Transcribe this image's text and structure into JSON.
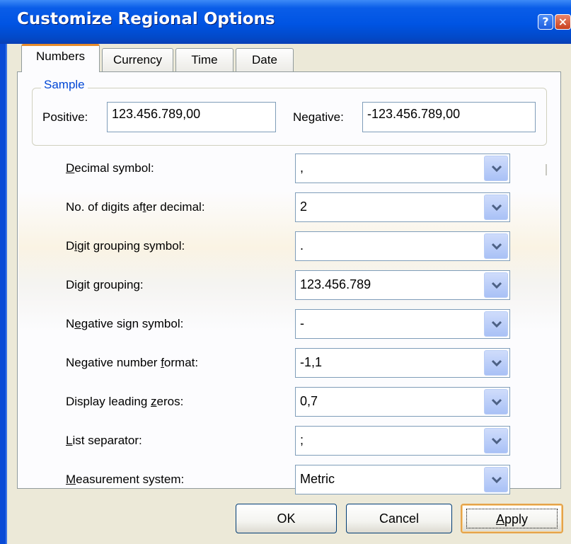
{
  "window": {
    "title": "Customize Regional Options",
    "help_glyph": "?",
    "close_glyph": "×"
  },
  "tabs": [
    {
      "label": "Numbers",
      "active": true
    },
    {
      "label": "Currency",
      "active": false
    },
    {
      "label": "Time",
      "active": false
    },
    {
      "label": "Date",
      "active": false
    }
  ],
  "sample": {
    "legend": "Sample",
    "positive_label": "Positive:",
    "positive_value": "123.456.789,00",
    "negative_label": "Negative:",
    "negative_value": "-123.456.789,00"
  },
  "settings": [
    {
      "pre": "",
      "key": "D",
      "post": "ecimal symbol:",
      "value": ","
    },
    {
      "pre": "No. of digits af",
      "key": "t",
      "post": "er decimal:",
      "value": "2"
    },
    {
      "pre": "D",
      "key": "i",
      "post": "git grouping symbol:",
      "value": "."
    },
    {
      "pre": "Di",
      "key": "g",
      "post": "it grouping:",
      "value": "123.456.789"
    },
    {
      "pre": "N",
      "key": "e",
      "post": "gative sign symbol:",
      "value": "-"
    },
    {
      "pre": "Negative number ",
      "key": "f",
      "post": "ormat:",
      "value": "-1,1"
    },
    {
      "pre": "Display leading ",
      "key": "z",
      "post": "eros:",
      "value": "0,7"
    },
    {
      "pre": "",
      "key": "L",
      "post": "ist separator:",
      "value": ";"
    },
    {
      "pre": "",
      "key": "M",
      "post": "easurement system:",
      "value": "Metric"
    }
  ],
  "buttons": {
    "ok": "OK",
    "cancel": "Cancel",
    "apply_key": "A",
    "apply_rest": "pply"
  },
  "icons": {
    "dropdown": "chevron-down-icon"
  },
  "colors": {
    "titlebar": "#0054e3",
    "dialog_bg": "#ece9d8",
    "tab_accent": "#e68b2c",
    "legend_text": "#0046d5",
    "combo_button": "#b9cdf5"
  }
}
